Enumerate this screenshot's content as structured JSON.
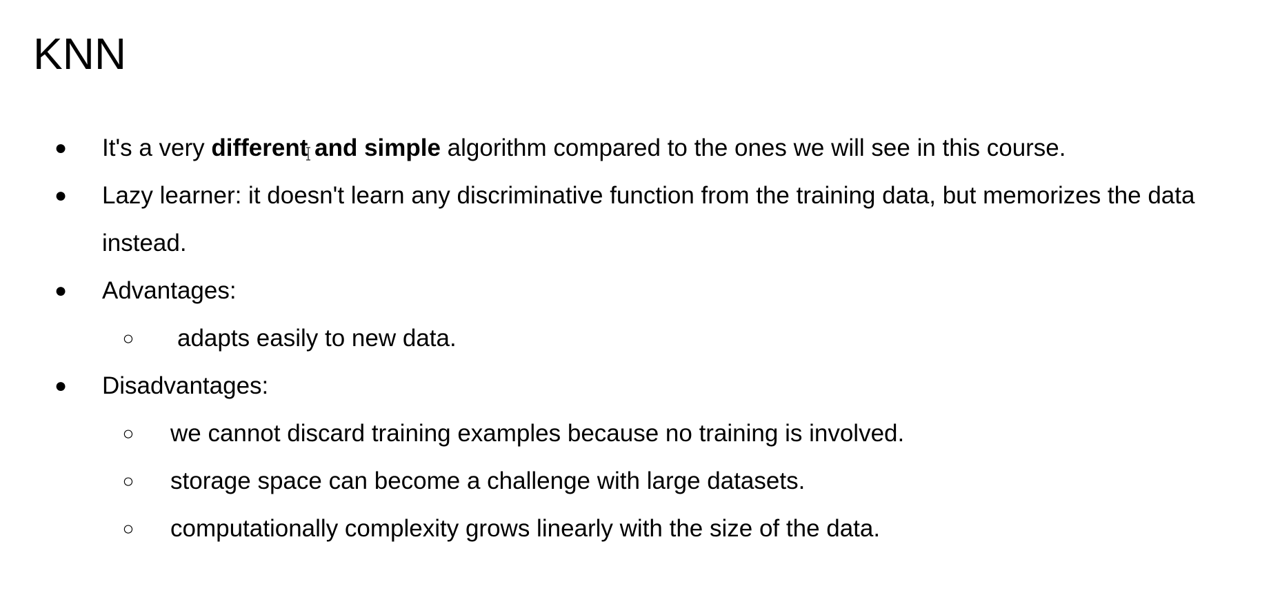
{
  "title": "KNN",
  "bullets": {
    "b1": {
      "pre": "It's a very ",
      "bold": "different and simple",
      "post": " algorithm compared to the ones we will see in this course."
    },
    "b2": "Lazy learner: it doesn't learn any discriminative function from the training data, but memorizes the data instead.",
    "b3": "Advantages:",
    "b3_sub": [
      "adapts easily to new data."
    ],
    "b4": "Disadvantages:",
    "b4_sub": [
      "we cannot discard training examples because no training is involved.",
      "storage space can become a challenge with large datasets.",
      "computationally complexity grows linearly with the size of the data."
    ]
  },
  "bullet_glyph": "●",
  "sub_bullet_glyph": "○",
  "text_cursor_icon": "text-cursor-icon"
}
